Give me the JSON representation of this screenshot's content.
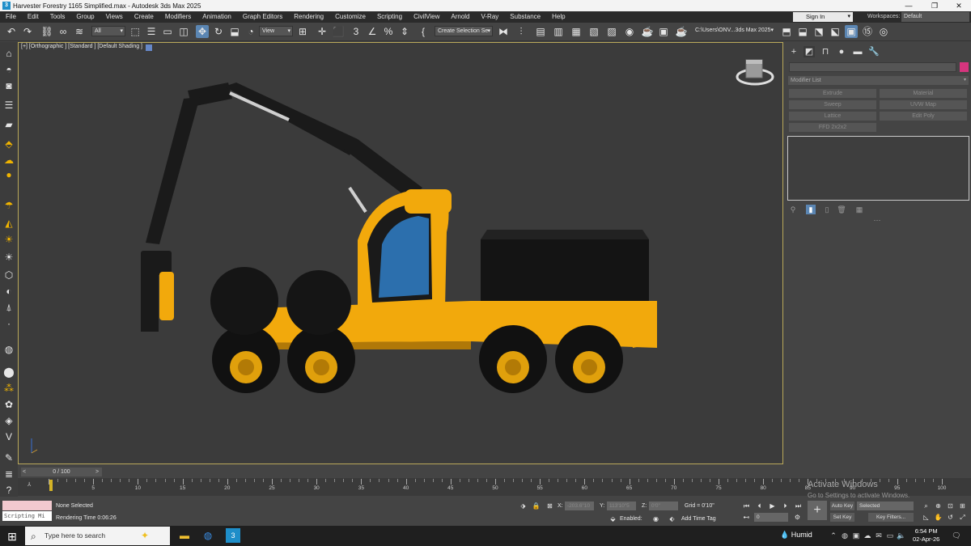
{
  "window": {
    "title": "Harvester Forestry 1165 Simplified.max - Autodesk 3ds Max 2025"
  },
  "menu": [
    "File",
    "Edit",
    "Tools",
    "Group",
    "Views",
    "Create",
    "Modifiers",
    "Animation",
    "Graph Editors",
    "Rendering",
    "Customize",
    "Scripting",
    "CivilView",
    "Arnold",
    "V-Ray",
    "Substance",
    "Help"
  ],
  "account": {
    "signin": "Sign In",
    "workspaces_label": "Workspaces:",
    "workspace": "Default"
  },
  "toolbar": {
    "filter": "All",
    "refcoord": "View",
    "selection_set": "Create Selection Se",
    "project_path": "C:\\Users\\ONV...3ds Max 2025"
  },
  "viewport": {
    "label": "[+] [Orthographic ] [Standard ] [Default Shading ]"
  },
  "command_panel": {
    "modifier_list": "Modifier List",
    "modifier_buttons": [
      "Extrude",
      "Material",
      "Sweep",
      "UVW Map",
      "Lattice",
      "Edit Poly",
      "FFD 2x2x2"
    ]
  },
  "timeline": {
    "slider": "0 / 100",
    "prev": "<",
    "next": ">",
    "ticks": [
      "0",
      "5",
      "10",
      "15",
      "20",
      "25",
      "30",
      "35",
      "40",
      "45",
      "50",
      "55",
      "60",
      "65",
      "70",
      "75",
      "80",
      "85",
      "90",
      "95",
      "100"
    ]
  },
  "status": {
    "script_text": "Scripting Mi",
    "selection": "None Selected",
    "render_time": "Rendering Time  0:06:26",
    "x_label": "X:",
    "x_value": "-203.6\"10",
    "y_label": "Y:",
    "y_value": "113'10\"5",
    "z_label": "Z:",
    "z_value": "0'0\"",
    "grid": "Grid = 0'10\"",
    "enabled": "Enabled:",
    "add_time_tag": "Add Time Tag",
    "auto_key": "Auto Key",
    "set_key": "Set Key",
    "key_mode": "Selected",
    "key_filters": "Key Filters...",
    "frame": "0"
  },
  "activation": {
    "line1": "Activate Windows",
    "line2": "Go to Settings to activate Windows."
  },
  "taskbar": {
    "search": "Type here to search",
    "weather": "Humid",
    "time": "6:54 PM",
    "date": "02-Apr-26"
  },
  "colors": {
    "machine_yellow": "#f2a90c",
    "machine_black": "#1a1a1a",
    "glass_blue": "#2c6fad",
    "viewport_bg": "#3b3b3b",
    "accent_blue": "#5b86b3",
    "object_color": "#d6357e"
  }
}
